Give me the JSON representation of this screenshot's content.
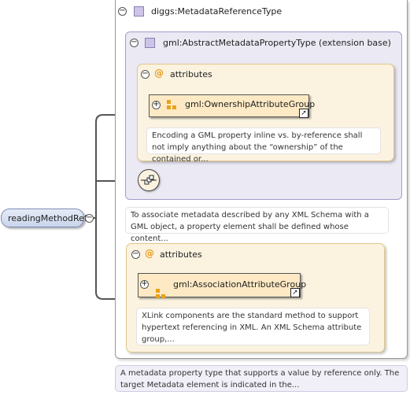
{
  "element": {
    "name": "readingMethodRef"
  },
  "type": {
    "name": "diggs:MetadataReferenceType",
    "doc": "A metadata property type that supports a value by reference only. The target Metadata element is indicated in the..."
  },
  "base": {
    "name": "gml:AbstractMetadataPropertyType (extension base)",
    "doc": "To associate metadata described by any XML Schema with a GML object, a property element shall be defined whose content...",
    "attributes": {
      "label": "attributes",
      "group_name": "gml:OwnershipAttributeGroup",
      "group_doc": "Encoding a GML property inline vs. by-reference shall not imply anything about the “ownership” of the contained or..."
    }
  },
  "attributes2": {
    "label": "attributes",
    "group_name": "gml:AssociationAttributeGroup",
    "group_doc": "XLink components are the standard method to support hypertext referencing in XML. An XML Schema attribute group,..."
  },
  "icons": {
    "collapse": "minus-circle-icon",
    "expand": "plus-circle-icon",
    "complex_type": "complex-type-icon",
    "attribute": "at-sign-icon",
    "attribute_group": "attribute-group-icon",
    "goto": "goto-arrow-icon",
    "sequence": "sequence-compositor-icon"
  }
}
